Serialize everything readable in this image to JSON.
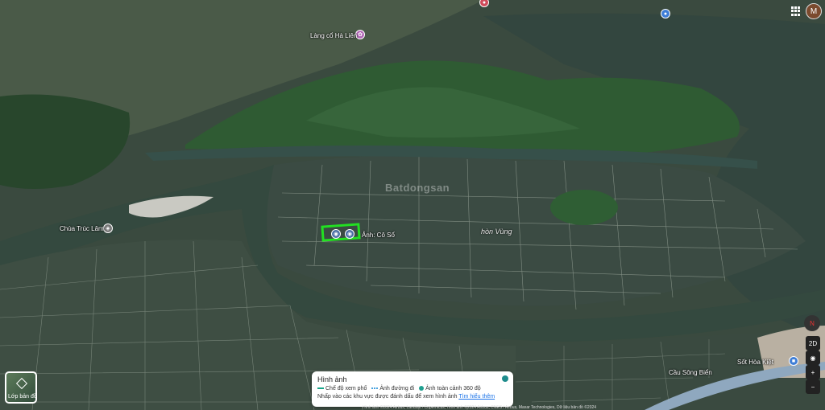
{
  "places": {
    "lang_co": "Làng cổ Hà Liên",
    "chua": "Chùa Trúc Lâm",
    "anh_co": "Ảnh: Cô Sổ",
    "hon_vung": "hòn Vùng",
    "bus": "Sốt Hòa Kiệt",
    "cau": "Cầu Sông Biển"
  },
  "watermark": "Batdongsan",
  "header": {
    "avatar_letter": "M"
  },
  "controls": {
    "compass": "N",
    "view_2d": "2D",
    "locate": "◉",
    "zoom_in": "+",
    "zoom_out": "−"
  },
  "layers_button": {
    "label": "Lớp bản đồ"
  },
  "photo_panel": {
    "title": "Hình ảnh",
    "street_view": "Chế độ xem phố",
    "road_photo": "Ảnh đường đi",
    "panorama": "Ảnh toàn cảnh 360 độ",
    "desc": "Nhấp vào các khu vực được đánh dấu để xem hình ảnh",
    "learn_more": "Tìm hiểu thêm"
  },
  "attribution": "Hình ảnh ©2024 Airbus, Landsat / Copernicus, Hình ảnh ©2024 Airbus, CNES / Airbus, Maxar Technologies, Dữ liệu bản đồ ©2024",
  "colors": {
    "highlight": "#22e022",
    "water": "#33463f",
    "hill": "#2f5b33"
  }
}
